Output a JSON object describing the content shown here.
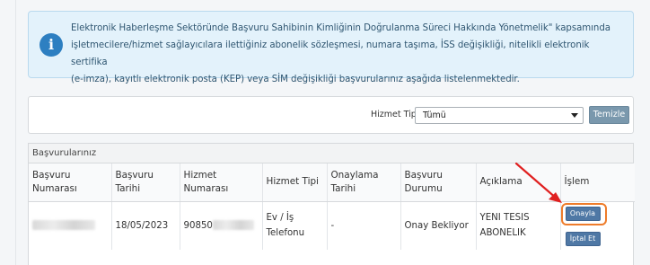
{
  "info": {
    "icon": "info-icon",
    "lines": [
      "Elektronik Haberleşme Sektöründe Başvuru Sahibinin Kimliğinin Doğrulanma Süreci Hakkında Yönetmelik\" kapsamında",
      "işletmecilere/hizmet sağlayıcılara ilettiğiniz abonelik sözleşmesi, numara taşıma, İSS değişikliği, nitelikli elektronik sertifika",
      "(e-imza), kayıtlı elektronik posta (KEP) veya SİM değişikliği başvurularınız aşağıda listelenmektedir."
    ]
  },
  "filter": {
    "label": "Hizmet Tipi",
    "selected": "Tümü",
    "clear_label": "Temizle"
  },
  "table": {
    "panel_title": "Başvurularınız",
    "headers": [
      "Başvuru Numarası",
      "Başvuru Tarihi",
      "Hizmet Numarası",
      "Hizmet Tipi",
      "Onaylama Tarihi",
      "Başvuru Durumu",
      "Açıklama",
      "İşlem"
    ],
    "rows": [
      {
        "basvuru_tarihi": "18/05/2023",
        "hizmet_numarasi_prefix": "90850",
        "hizmet_tipi": "Ev / İş Telefonu",
        "onaylama_tarihi": "-",
        "basvuru_durumu": "Onay Bekliyor",
        "aciklama": "YENI TESIS ABONELIK",
        "approve_label": "Onayla",
        "cancel_label": "İptal Et"
      }
    ]
  },
  "colors": {
    "accent": "#4f78a5",
    "highlight": "#ee7c2b",
    "arrow": "#e02020",
    "info_bg": "#e3f2fb"
  }
}
